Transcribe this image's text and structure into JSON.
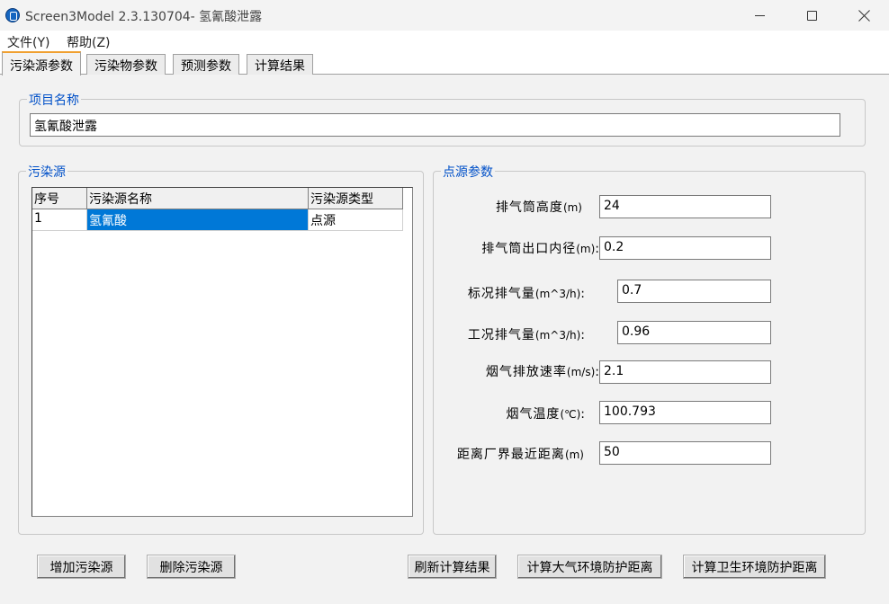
{
  "window": {
    "title": "Screen3Model 2.3.130704- 氢氰酸泄露"
  },
  "menu": [
    {
      "label": "文件(Y)"
    },
    {
      "label": "帮助(Z)"
    }
  ],
  "tabs": [
    {
      "label": "污染源参数"
    },
    {
      "label": "污染物参数"
    },
    {
      "label": "预测参数"
    },
    {
      "label": "计算结果"
    }
  ],
  "project": {
    "legend": "项目名称",
    "name": "氢氰酸泄露"
  },
  "sources": {
    "legend": "污染源",
    "columns": [
      "序号",
      "污染源名称",
      "污染源类型"
    ],
    "rows": [
      {
        "index": "1",
        "name": "氢氰酸",
        "type": "点源"
      }
    ]
  },
  "point_params": {
    "legend": "点源参数",
    "fields": [
      {
        "label": "排气筒高度",
        "unit": "(m)",
        "suffix": "",
        "value": "24"
      },
      {
        "label": "排气筒出口内径",
        "unit": "(m)",
        "suffix": ":",
        "value": "0.2"
      },
      {
        "label": "标况排气量",
        "unit": "(m^3/h)",
        "suffix": ":",
        "value": "0.7"
      },
      {
        "label": "工况排气量",
        "unit": "(m^3/h)",
        "suffix": ":",
        "value": "0.96"
      },
      {
        "label": "烟气排放速率",
        "unit": "(m/s)",
        "suffix": ":",
        "value": "2.1"
      },
      {
        "label": "烟气温度",
        "unit": "(℃)",
        "suffix": ":",
        "value": "100.793"
      },
      {
        "label": "距离厂界最近距离",
        "unit": "(m)",
        "suffix": "",
        "value": "50"
      }
    ]
  },
  "buttons": {
    "add_source": "增加污染源",
    "delete_source": "删除污染源",
    "refresh": "刷新计算结果",
    "calc_air": "计算大气环境防护距离",
    "calc_health": "计算卫生环境防护距离"
  },
  "colors": {
    "selection": "#0078d7",
    "legend_text": "#0050c8",
    "active_tab_accent": "#f0a030"
  }
}
